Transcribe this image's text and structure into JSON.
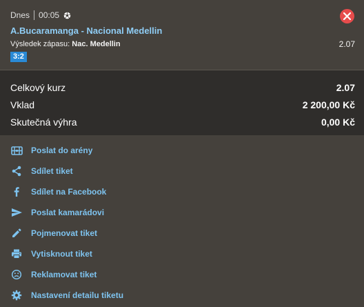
{
  "bet": {
    "time_label": "Dnes",
    "time": "00:05",
    "sport_icon": "soccer-ball-icon",
    "match": "A.Bucaramanga - Nacional Medellin",
    "market_label": "Výsledek zápasu:",
    "selection": "Nac. Medellin",
    "odd": "2.07",
    "score": "3:2"
  },
  "summary": {
    "total_odds_label": "Celkový kurz",
    "total_odds": "2.07",
    "stake_label": "Vklad",
    "stake": "2 200,00 Kč",
    "win_label": "Skutečná výhra",
    "win": "0,00 Kč"
  },
  "actions": [
    {
      "label": "Poslat do arény",
      "icon": "arena-icon"
    },
    {
      "label": "Sdílet tiket",
      "icon": "share-icon"
    },
    {
      "label": "Sdílet na Facebook",
      "icon": "facebook-icon"
    },
    {
      "label": "Poslat kamarádovi",
      "icon": "send-icon"
    },
    {
      "label": "Pojmenovat tiket",
      "icon": "pencil-icon"
    },
    {
      "label": "Vytisknout tiket",
      "icon": "print-icon"
    },
    {
      "label": "Reklamovat tiket",
      "icon": "complaint-icon"
    },
    {
      "label": "Nastavení detailu tiketu",
      "icon": "gear-icon"
    }
  ],
  "colors": {
    "link": "#7ec3ef",
    "close": "#e74c4c",
    "score_badge": "#2a8ad6"
  }
}
